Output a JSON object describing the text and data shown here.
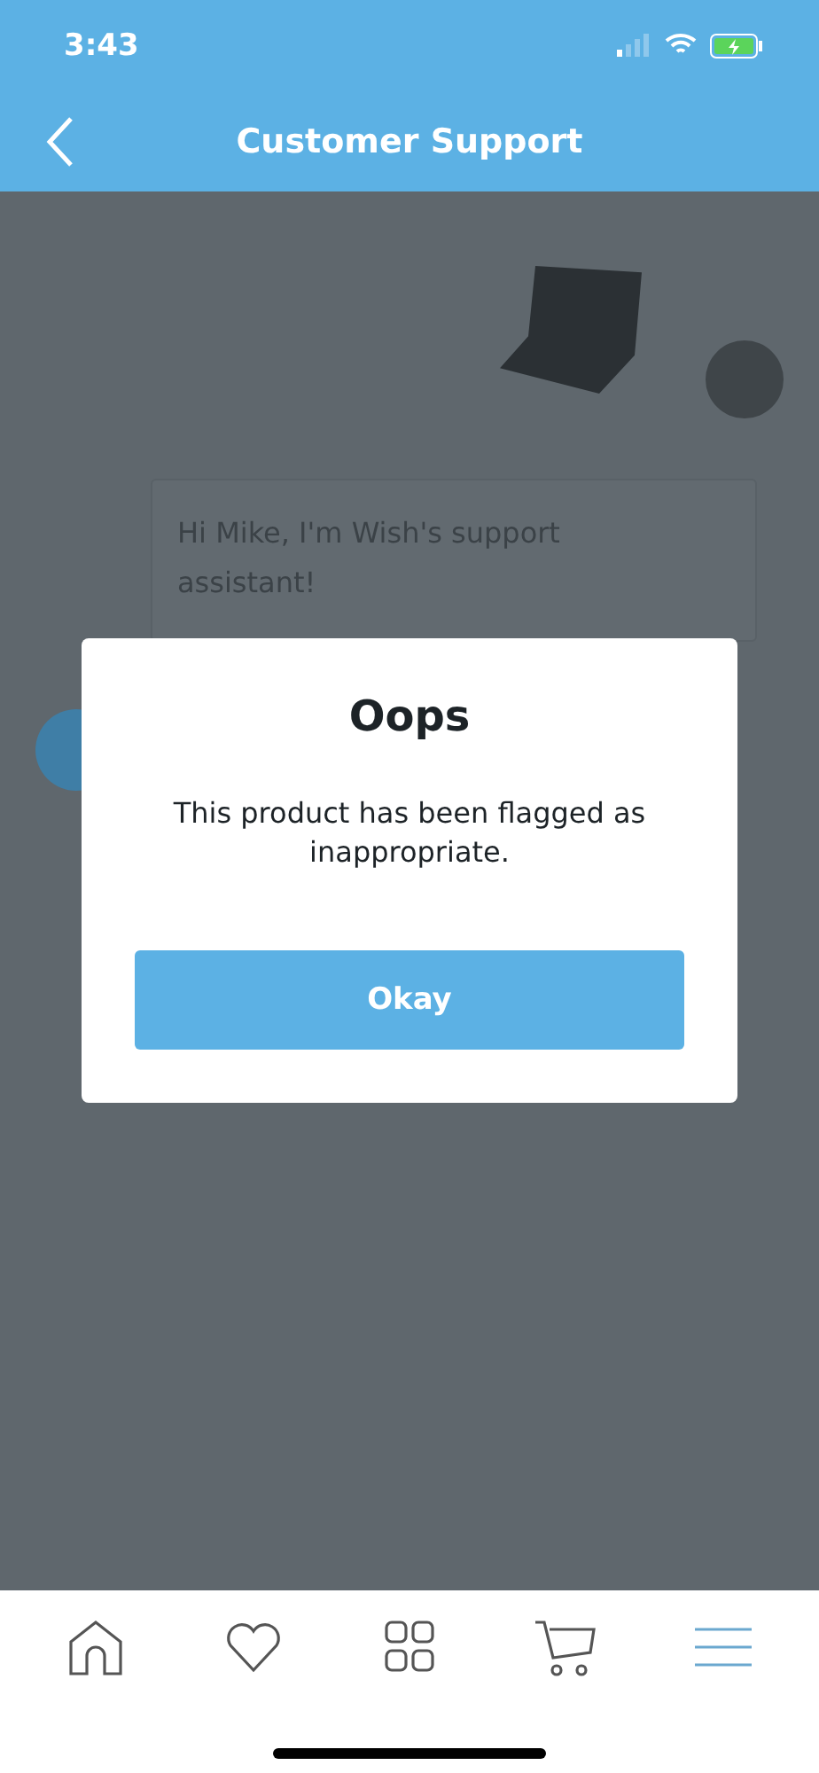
{
  "status_bar": {
    "time": "3:43"
  },
  "nav": {
    "title": "Customer Support"
  },
  "messages": [
    {
      "kind": "image"
    },
    {
      "kind": "text",
      "text": "Hi Mike, I'm Wish's support assistant!"
    },
    {
      "kind": "avatar"
    }
  ],
  "dialog": {
    "title": "Oops",
    "message": "This product has been flagged as inappropriate.",
    "button": "Okay"
  },
  "tabs": [
    {
      "kind": "home",
      "selected": false
    },
    {
      "kind": "heart",
      "selected": false
    },
    {
      "kind": "grid",
      "selected": false
    },
    {
      "kind": "cart",
      "selected": false
    },
    {
      "kind": "menu",
      "selected": true
    }
  ]
}
